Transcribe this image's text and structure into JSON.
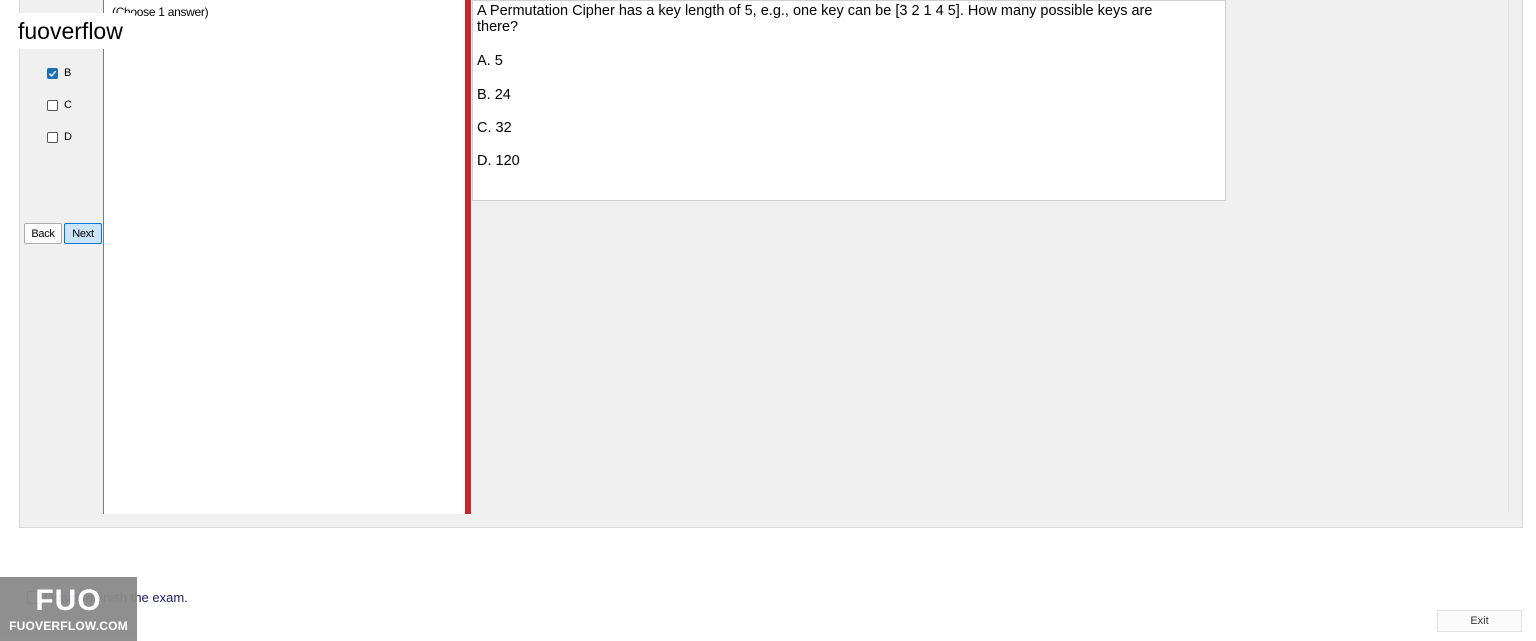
{
  "watermark": {
    "text": "fuoverflow"
  },
  "answer_options": [
    {
      "label": "B",
      "checked": true
    },
    {
      "label": "C",
      "checked": false
    },
    {
      "label": "D",
      "checked": false
    }
  ],
  "nav": {
    "back_label": "Back",
    "next_label": "Next"
  },
  "answer_panel": {
    "hint": "(Choose 1 answer)"
  },
  "question": {
    "text": "A Permutation Cipher has a key length of 5, e.g., one key can be [3 2 1 4 5]. How many possible keys are there?",
    "options": [
      "A.  5",
      "B.  24",
      "C.  32",
      "D.  120"
    ]
  },
  "footer": {
    "finish_text": "I want to finish the exam.",
    "exit_label": "Exit",
    "logo_big": "FUO",
    "logo_small": "FUOVERFLOW.COM"
  },
  "colors": {
    "accent": "#1b6fb5",
    "splitter": "#c2272d",
    "next_bg": "#cce4f7"
  }
}
